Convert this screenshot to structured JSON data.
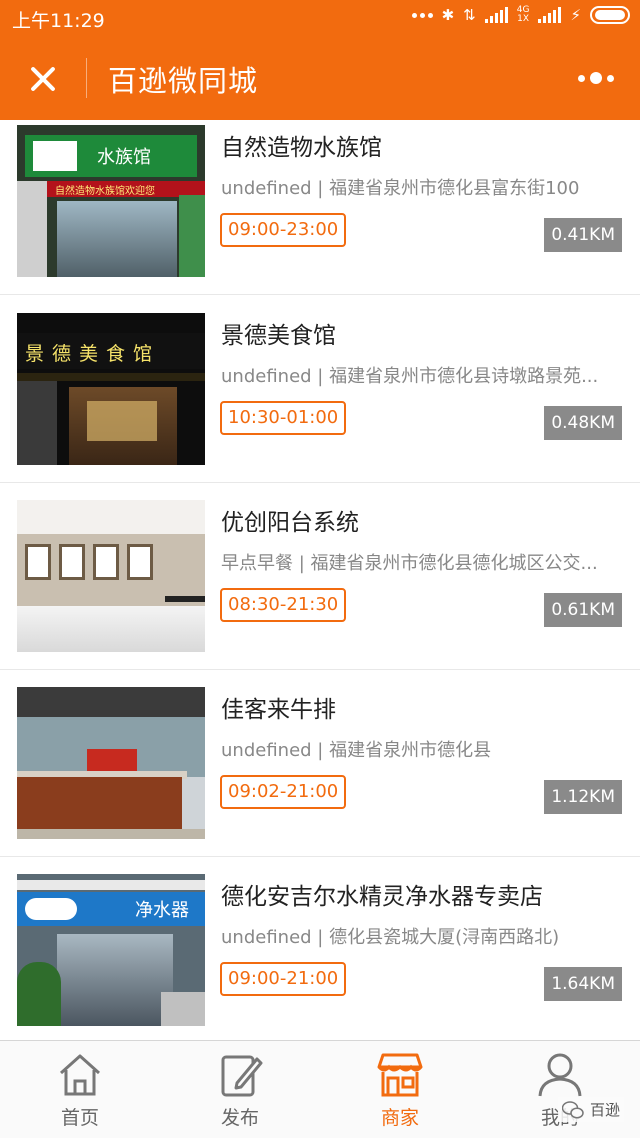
{
  "status_bar": {
    "time": "上午11:29",
    "network": "4G\n1X",
    "icons": [
      "dots-icon",
      "bluetooth-icon",
      "data-arrows-icon",
      "signal-icon",
      "signal-icon",
      "charging-icon",
      "battery-icon"
    ]
  },
  "header": {
    "title": "百逊微同城",
    "close_icon": "close-icon",
    "more_icon": "more-icon"
  },
  "stores": [
    {
      "name": "自然造物水族馆",
      "address": "undefined | 福建省泉州市德化县富东街100",
      "hours": "09:00-23:00",
      "distance": "0.41KM",
      "thumb_sign": "水族馆",
      "thumb_band": "自然造物水族馆欢迎您"
    },
    {
      "name": "景德美食馆",
      "address": "undefined | 福建省泉州市德化县诗墩路景苑...",
      "hours": "10:30-01:00",
      "distance": "0.48KM",
      "thumb_sign": "景德美食馆"
    },
    {
      "name": "优创阳台系统",
      "address": "早点早餐 | 福建省泉州市德化县德化城区公交...",
      "hours": "08:30-21:30",
      "distance": "0.61KM"
    },
    {
      "name": "佳客来牛排",
      "address": "undefined | 福建省泉州市德化县",
      "hours": "09:02-21:00",
      "distance": "1.12KM"
    },
    {
      "name": "德化安吉尔水精灵净水器专卖店",
      "address": "undefined | 德化县瓷城大厦(浔南西路北)",
      "hours": "09:00-21:00",
      "distance": "1.64KM",
      "thumb_sign": "净水器"
    }
  ],
  "tabs": [
    {
      "label": "首页",
      "icon": "home-icon",
      "active": false
    },
    {
      "label": "发布",
      "icon": "edit-icon",
      "active": false
    },
    {
      "label": "商家",
      "icon": "shop-icon",
      "active": true
    },
    {
      "label": "我的",
      "icon": "user-icon",
      "active": false
    }
  ],
  "watermark": {
    "text": "百逊",
    "icon": "wechat-icon"
  },
  "colors": {
    "brand": "#f26b0f",
    "distance_badge": "#8a8a8a",
    "text_gray": "#888888"
  }
}
